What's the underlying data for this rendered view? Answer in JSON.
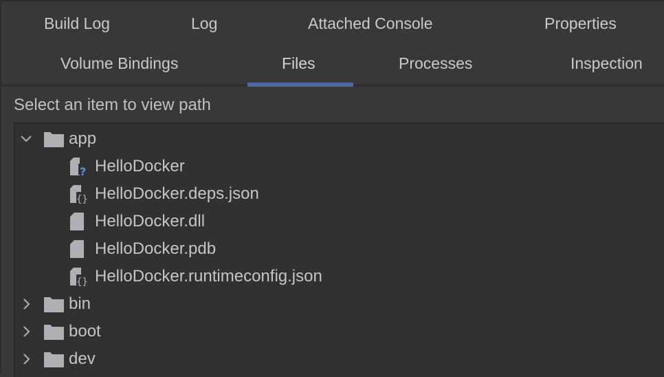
{
  "tabs": {
    "row1": [
      {
        "label": "Build Log"
      },
      {
        "label": "Log"
      },
      {
        "label": "Attached Console"
      },
      {
        "label": "Properties"
      }
    ],
    "row2": [
      {
        "label": "Volume Bindings"
      },
      {
        "label": "Files",
        "active": true
      },
      {
        "label": "Processes"
      },
      {
        "label": "Inspection"
      }
    ],
    "active_color": "#4f6aa3"
  },
  "path_label": "Select an item to view path",
  "tree": {
    "items": [
      {
        "name": "app",
        "type": "folder",
        "expanded": true,
        "depth": 0
      },
      {
        "name": "HelloDocker",
        "type": "file-unknown",
        "depth": 1
      },
      {
        "name": "HelloDocker.deps.json",
        "type": "file-json",
        "depth": 1
      },
      {
        "name": "HelloDocker.dll",
        "type": "file",
        "depth": 1
      },
      {
        "name": "HelloDocker.pdb",
        "type": "file",
        "depth": 1
      },
      {
        "name": "HelloDocker.runtimeconfig.json",
        "type": "file-json",
        "depth": 1
      },
      {
        "name": "bin",
        "type": "folder",
        "expanded": false,
        "depth": 0
      },
      {
        "name": "boot",
        "type": "folder",
        "expanded": false,
        "depth": 0
      },
      {
        "name": "dev",
        "type": "folder",
        "expanded": false,
        "depth": 0
      }
    ]
  }
}
